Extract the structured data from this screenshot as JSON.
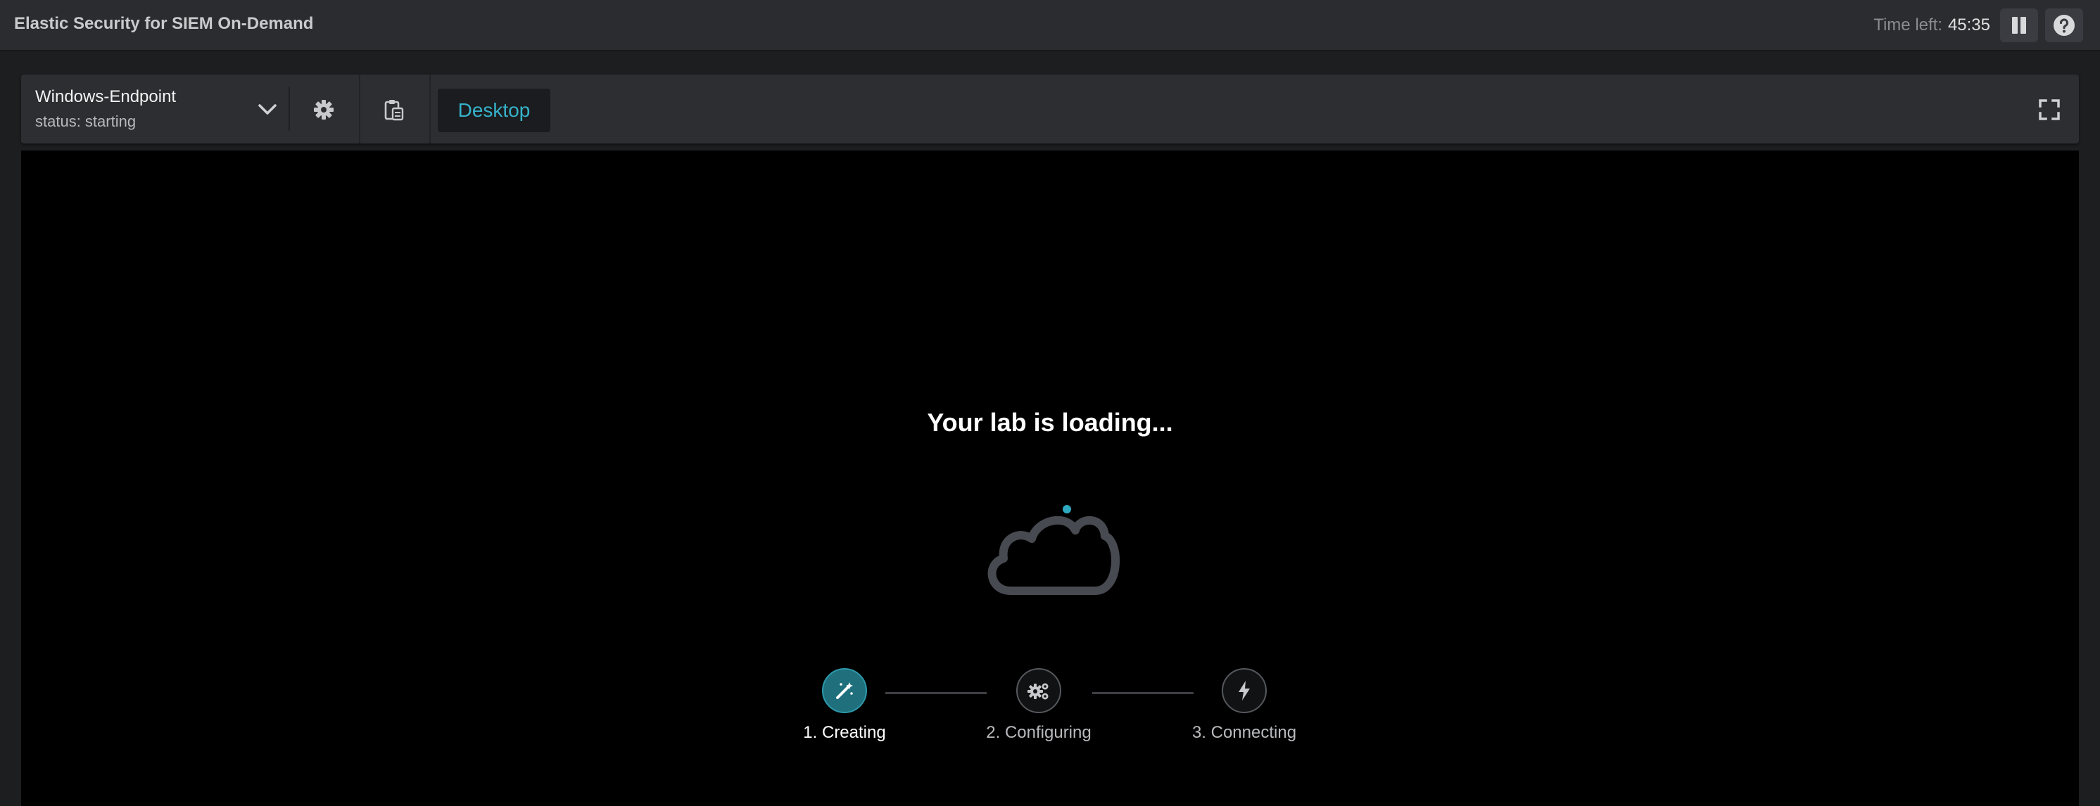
{
  "app": {
    "title": "Elastic Security for SIEM On-Demand",
    "time_left_label": "Time left:",
    "time_left_value": "45:35"
  },
  "toolbar": {
    "vm_name": "Windows-Endpoint",
    "vm_status": "status: starting",
    "desktop_tab": "Desktop"
  },
  "viewer": {
    "loading_title": "Your lab is loading...",
    "steps": [
      {
        "label": "1. Creating",
        "icon": "wand-icon",
        "active": true
      },
      {
        "label": "2. Configuring",
        "icon": "gears-icon",
        "active": false
      },
      {
        "label": "3. Connecting",
        "icon": "bolt-icon",
        "active": false
      }
    ]
  },
  "colors": {
    "accent": "#35b2c9",
    "active_step": "#1f6f7c",
    "background": "#1d1e20",
    "viewer": "#000000"
  }
}
